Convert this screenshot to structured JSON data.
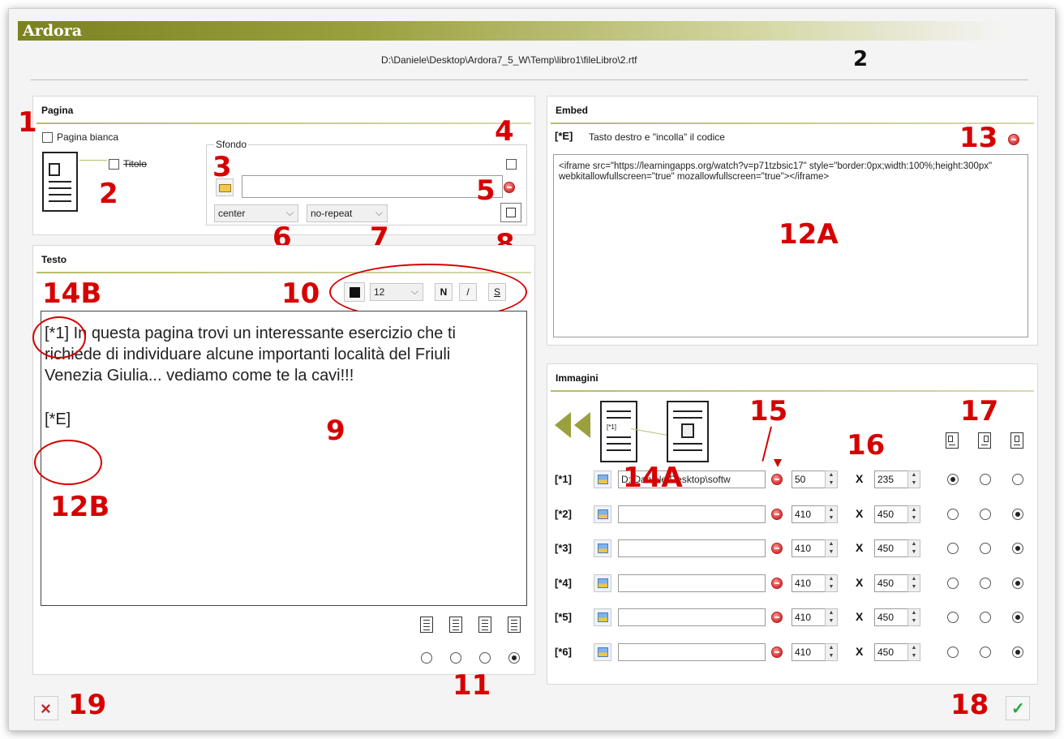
{
  "app": {
    "title": "Ardora",
    "file_path": "D:\\Daniele\\Desktop\\Ardora7_5_W\\Temp\\libro1\\fileLibro\\2.rtf"
  },
  "pagina": {
    "title": "Pagina",
    "blank_page_label": "Pagina bianca",
    "title_checkbox_label": "Titolo",
    "background_group_label": "Sfondo",
    "bg_file_value": "",
    "position_select": "center",
    "repeat_select": "no-repeat"
  },
  "testo": {
    "title": "Testo",
    "font_size": "12",
    "bold_label": "N",
    "italic_label": "/",
    "strike_label": "S",
    "content_paragraph": "[*1] In questa pagina trovi un interessante esercizio che ti richiede di individuare alcune importanti località del Friuli Venezia Giulia... vediamo come te la cavi!!!",
    "content_embed_tag": "[*E]"
  },
  "embed": {
    "title": "Embed",
    "tag": "[*E]",
    "hint": "Tasto destro e \"incolla\" il codice",
    "code": "<iframe src=\"https://learningapps.org/watch?v=p71tzbsic17\" style=\"border:0px;width:100%;height:300px\" webkitallowfullscreen=\"true\" mozallowfullscreen=\"true\"></iframe>"
  },
  "immagini": {
    "title": "Immagini",
    "rows": [
      {
        "label": "[*1]",
        "path": "D:\\Daniele\\Desktop\\softw",
        "w": "50",
        "h": "235",
        "align": 0
      },
      {
        "label": "[*2]",
        "path": "",
        "w": "410",
        "h": "450",
        "align": 2
      },
      {
        "label": "[*3]",
        "path": "",
        "w": "410",
        "h": "450",
        "align": 2
      },
      {
        "label": "[*4]",
        "path": "",
        "w": "410",
        "h": "450",
        "align": 2
      },
      {
        "label": "[*5]",
        "path": "",
        "w": "410",
        "h": "450",
        "align": 2
      },
      {
        "label": "[*6]",
        "path": "",
        "w": "410",
        "h": "450",
        "align": 2
      }
    ],
    "times_symbol": "X"
  },
  "annotations": {
    "n1": "1",
    "n2": "2",
    "n2b": "2",
    "n3": "3",
    "n4": "4",
    "n5": "5",
    "n6": "6",
    "n7": "7",
    "n8": "8",
    "n9": "9",
    "n10": "10",
    "n11": "11",
    "n12a": "12A",
    "n12b": "12B",
    "n13": "13",
    "n14a": "14A",
    "n14b": "14B",
    "n15": "15",
    "n16": "16",
    "n17": "17",
    "n18": "18",
    "n19": "19"
  },
  "colors": {
    "annotation": "#d60000",
    "accent_olive": "#7b8220",
    "ok_green": "#22a83a",
    "cancel_red": "#c0282c"
  }
}
